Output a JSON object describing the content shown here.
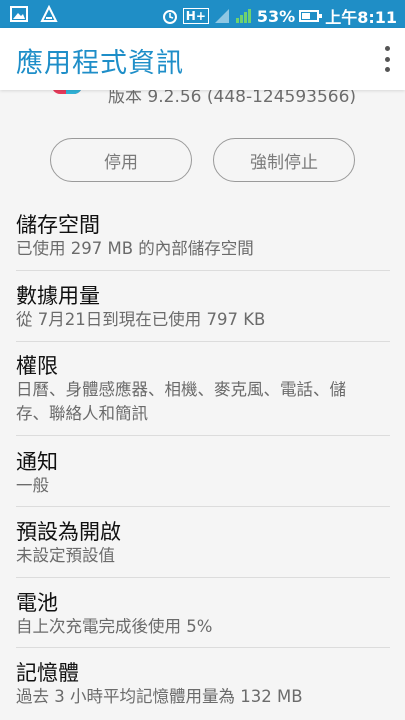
{
  "status": {
    "battery": "53%",
    "time": "上午8:11",
    "network": "H+",
    "battery_level": 0.53
  },
  "appbar": {
    "title": "應用程式資訊"
  },
  "version": "版本 9.2.56 (448-124593566)",
  "buttons": {
    "disable": "停用",
    "force_stop": "強制停止"
  },
  "items": [
    {
      "title": "儲存空間",
      "sub": "已使用 297 MB 的內部儲存空間"
    },
    {
      "title": "數據用量",
      "sub": "從 7月21日到現在已使用 797 KB"
    },
    {
      "title": "權限",
      "sub": "日曆、身體感應器、相機、麥克風、電話、儲存、聯絡人和簡訊"
    },
    {
      "title": "通知",
      "sub": "一般"
    },
    {
      "title": "預設為開啟",
      "sub": "未設定預設值"
    },
    {
      "title": "電池",
      "sub": "自上次充電完成後使用 5%"
    },
    {
      "title": "記憶體",
      "sub": "過去 3 小時平均記憶體用量為 132 MB"
    }
  ],
  "colors": {
    "status_bar": "#1f8ec6",
    "title": "#1e8ec8"
  }
}
